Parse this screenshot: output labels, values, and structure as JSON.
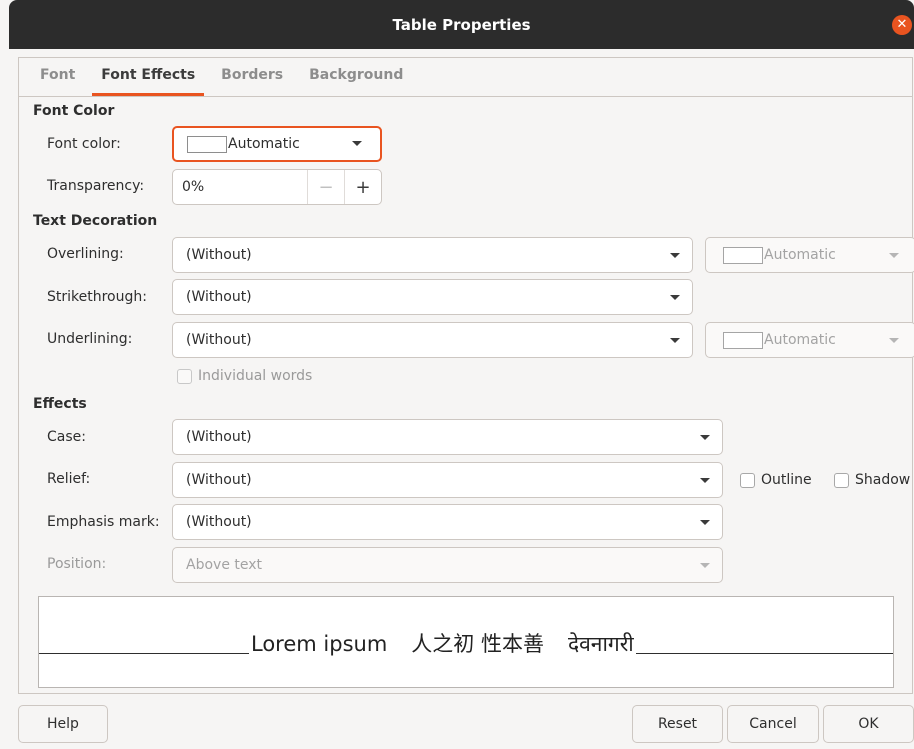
{
  "window": {
    "title": "Table Properties"
  },
  "tabs": [
    {
      "label": "Font"
    },
    {
      "label": "Font Effects"
    },
    {
      "label": "Borders"
    },
    {
      "label": "Background"
    }
  ],
  "font_color": {
    "heading": "Font Color",
    "color_label": "Font color:",
    "color_value": "Automatic",
    "transparency_label": "Transparency:",
    "transparency_value": "0%",
    "minus": "−",
    "plus": "+"
  },
  "decoration": {
    "heading": "Text Decoration",
    "overlining_label": "Overlining:",
    "overlining_value": "(Without)",
    "overline_color": "Automatic",
    "strikethrough_label": "Strikethrough:",
    "strikethrough_value": "(Without)",
    "underlining_label": "Underlining:",
    "underlining_value": "(Without)",
    "underline_color": "Automatic",
    "individual_words": "Individual words"
  },
  "effects": {
    "heading": "Effects",
    "case_label": "Case:",
    "case_value": "(Without)",
    "relief_label": "Relief:",
    "relief_value": "(Without)",
    "outline_label": "Outline",
    "shadow_label": "Shadow",
    "emphasis_label": "Emphasis mark:",
    "emphasis_value": "(Without)",
    "position_label": "Position:",
    "position_value": "Above text"
  },
  "preview": {
    "latin": "Lorem ipsum",
    "cjk": "人之初 性本善",
    "ctl": "देवनागरी"
  },
  "buttons": {
    "help": "Help",
    "reset": "Reset",
    "cancel": "Cancel",
    "ok": "OK"
  },
  "colors": {
    "accent": "#e95420",
    "titlebar": "#2c2c2c"
  }
}
